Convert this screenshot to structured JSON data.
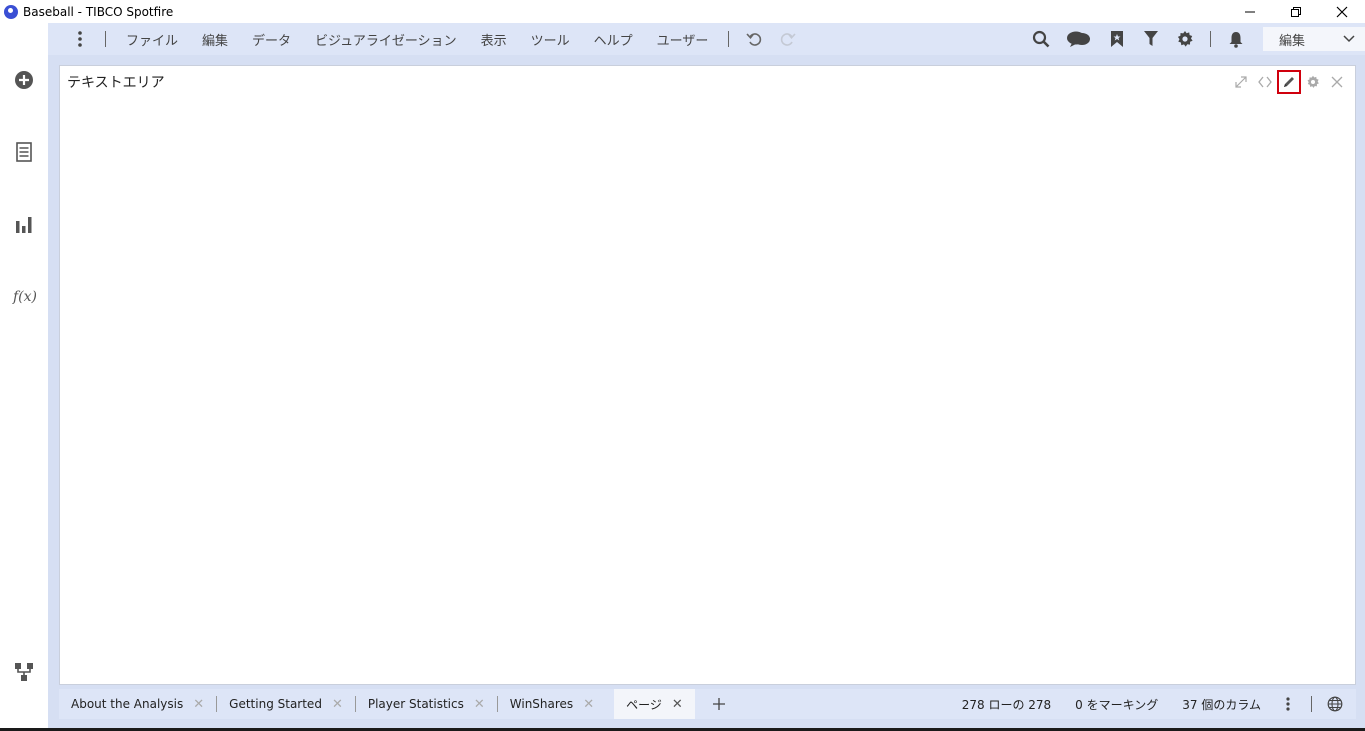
{
  "window": {
    "title": "Baseball - TIBCO Spotfire"
  },
  "menu": {
    "items": [
      "ファイル",
      "編集",
      "データ",
      "ビジュアライゼーション",
      "表示",
      "ツール",
      "ヘルプ",
      "ユーザー"
    ]
  },
  "mode": {
    "label": "編集"
  },
  "panel": {
    "title": "テキストエリア"
  },
  "tabs": [
    {
      "label": "About the Analysis",
      "active": false
    },
    {
      "label": "Getting Started",
      "active": false
    },
    {
      "label": "Player Statistics",
      "active": false
    },
    {
      "label": "WinShares",
      "active": false
    },
    {
      "label": "ページ",
      "active": true
    }
  ],
  "status": {
    "rows": "278 ローの 278",
    "marked": "0 をマーキング",
    "columns": "37 個のカラム"
  },
  "colors": {
    "frame_bg": "#d6dff3",
    "toolbar_bg": "#dde5f7",
    "highlight": "#d0000d",
    "logo": "#3a4fd4"
  }
}
